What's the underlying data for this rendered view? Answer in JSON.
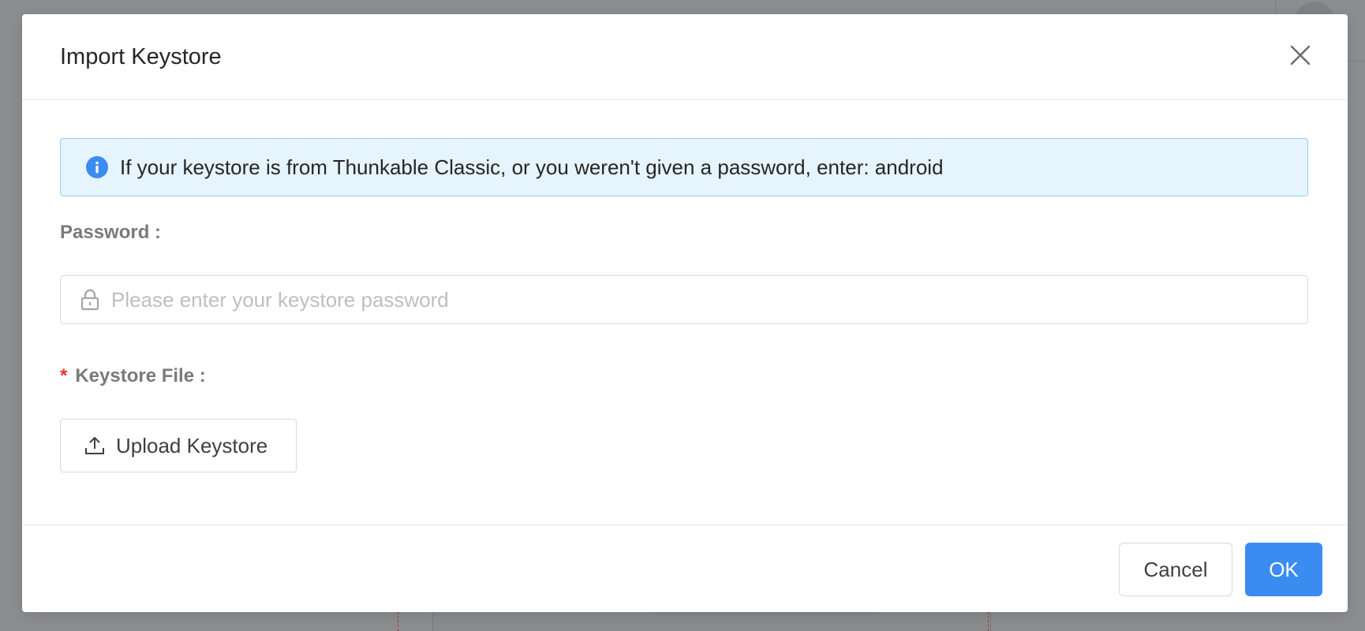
{
  "modal": {
    "title": "Import Keystore",
    "close_icon": "close-icon",
    "info": {
      "icon": "info-icon",
      "text": "If your keystore is from Thunkable Classic, or you weren't given a password, enter: android"
    },
    "password": {
      "label": "Password :",
      "placeholder": "Please enter your keystore password",
      "value": "",
      "icon": "lock-icon"
    },
    "keystore_file": {
      "required_mark": "*",
      "label": "Keystore File :",
      "upload_label": "Upload Keystore",
      "icon": "upload-icon"
    },
    "footer": {
      "cancel_label": "Cancel",
      "ok_label": "OK"
    }
  },
  "colors": {
    "primary": "#3b8cf0",
    "info_bg": "#e6f4fd",
    "info_border": "#93cdf5",
    "required": "#e53935",
    "overlay": "#8c8d8f"
  }
}
